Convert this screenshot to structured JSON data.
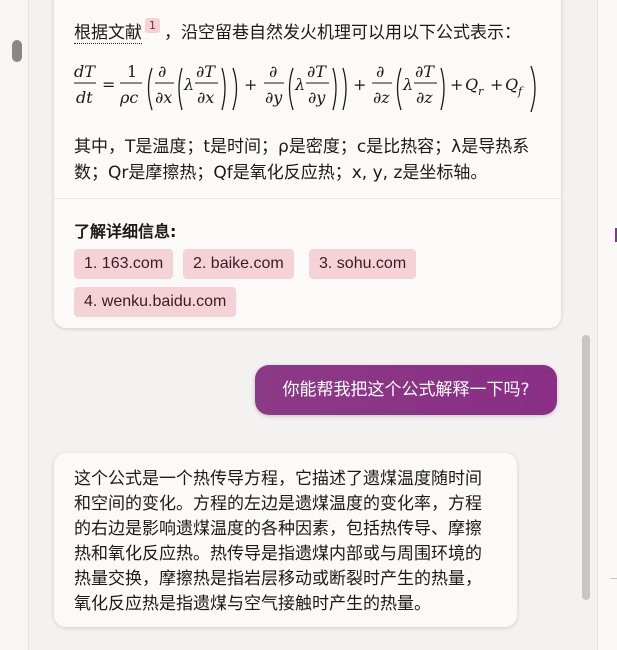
{
  "message_1": {
    "intro_link": "根据文献",
    "citation_badge": "1",
    "intro_rest": "，沿空留巷自然发火机理可以用以下公式表示：",
    "formula": {
      "lhs_num": "dT",
      "lhs_den": "dt",
      "eq": "=",
      "coef_num": "1",
      "coef_den": "ρc",
      "d": "∂",
      "lambda": "λ",
      "dT": "∂T",
      "dx": "∂x",
      "dy": "∂y",
      "dz": "∂z",
      "plus": "+",
      "Q": "Q",
      "sub_r": "r",
      "sub_f": "f"
    },
    "explanation_line1": "其中，T是温度；t是时间；ρ是密度；c是比热容；λ是导热系",
    "explanation_line2": "数；Qr是摩擦热；Qf是氧化反应热；x, y, z是坐标轴。",
    "learn_more_title": "了解详细信息:",
    "sources": [
      "1. 163.com",
      "2. baike.com",
      "3. sohu.com",
      "4. wenku.baidu.com"
    ]
  },
  "user_message": "你能帮我把这个公式解释一下吗?",
  "reply": {
    "lines": [
      "这个公式是一个热传导方程，它描述了遗煤温度随时间",
      "和空间的变化。方程的左边是遗煤温度的变化率，方程",
      "的右边是影响遗煤温度的各种因素，包括热传导、摩擦",
      "热和氧化反应热。热传导是指遗煤内部或与周围环境的",
      "热量交换，摩擦热是指岩层移动或断裂时产生的热量，",
      "氧化反应热是指遗煤与空气接触时产生的热量。"
    ]
  },
  "colors": {
    "user_bubble": "#8b3a86",
    "chip_background": "#f5d2d5",
    "accent": "#7a3a8f"
  }
}
